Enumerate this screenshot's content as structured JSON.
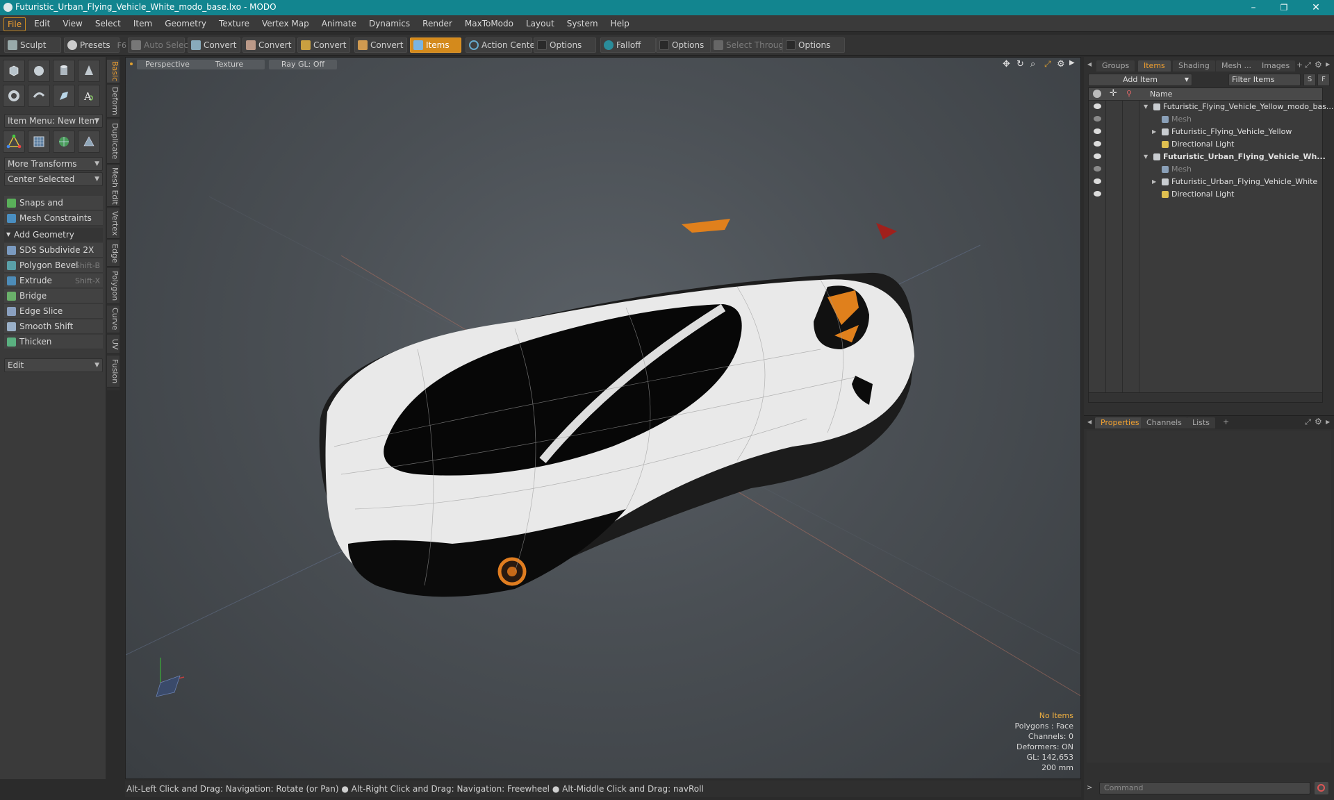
{
  "window": {
    "title": "Futuristic_Urban_Flying_Vehicle_White_modo_base.lxo - MODO",
    "controls": [
      "–",
      "❐",
      "✕"
    ]
  },
  "menu": [
    "File",
    "Edit",
    "View",
    "Select",
    "Item",
    "Geometry",
    "Texture",
    "Vertex Map",
    "Animate",
    "Dynamics",
    "Render",
    "MaxToModo",
    "Layout",
    "System",
    "Help"
  ],
  "toolbar": {
    "sculpt": "Sculpt",
    "presets": "Presets",
    "presets_key": "F6",
    "auto_select": "Auto Select",
    "convert1": "Convert",
    "convert2": "Convert",
    "convert3": "Convert",
    "convert4": "Convert",
    "items": "Items",
    "action_center": "Action Center",
    "options1": "Options",
    "falloff": "Falloff",
    "options2": "Options",
    "select_through": "Select Through",
    "options3": "Options"
  },
  "left": {
    "item_menu": "Item Menu: New Item",
    "more_transforms": "More Transforms",
    "center_selected": "Center Selected",
    "snaps": "Snaps and Precision",
    "mesh_constraints": "Mesh Constraints",
    "add_geometry": "Add Geometry",
    "tools": [
      {
        "label": "SDS Subdivide 2X",
        "key": ""
      },
      {
        "label": "Polygon Bevel",
        "key": "Shift-B"
      },
      {
        "label": "Extrude",
        "key": "Shift-X"
      },
      {
        "label": "Bridge",
        "key": ""
      },
      {
        "label": "Edge Slice",
        "key": ""
      },
      {
        "label": "Smooth Shift",
        "key": ""
      },
      {
        "label": "Thicken",
        "key": ""
      }
    ],
    "edit": "Edit"
  },
  "vtabs": [
    "Basic",
    "Deform",
    "Duplicate",
    "Mesh Edit",
    "Vertex",
    "Edge",
    "Polygon",
    "Curve",
    "UV",
    "Fusion"
  ],
  "viewport": {
    "perspective": "Perspective",
    "texture": "Texture",
    "raygl": "Ray GL: Off",
    "info": {
      "items": "No Items",
      "polygons": "Polygons : Face",
      "channels": "Channels: 0",
      "deformers": "Deformers: ON",
      "gl": "GL: 142,653",
      "scale": "200 mm"
    }
  },
  "status": "Alt-Left Click and Drag: Navigation: Rotate (or Pan) ● Alt-Right Click and Drag: Navigation: Freewheel ● Alt-Middle Click and Drag: navRoll",
  "right": {
    "tabs": [
      "Groups",
      "Items",
      "Shading",
      "Mesh ...",
      "Images"
    ],
    "add_item": "Add Item",
    "filter_items": "Filter Items",
    "s_btn": "S",
    "f_btn": "F",
    "name_col": "Name",
    "tree": [
      {
        "label": "Futuristic_Flying_Vehicle_Yellow_modo_bas...",
        "indent": 0,
        "bold": false,
        "dim": false
      },
      {
        "label": "Mesh",
        "indent": 1,
        "bold": false,
        "dim": true
      },
      {
        "label": "Futuristic_Flying_Vehicle_Yellow",
        "indent": 1,
        "bold": false,
        "dim": false
      },
      {
        "label": "Directional Light",
        "indent": 1,
        "bold": false,
        "dim": false
      },
      {
        "label": "Futuristic_Urban_Flying_Vehicle_Wh...",
        "indent": 0,
        "bold": true,
        "dim": false
      },
      {
        "label": "Mesh",
        "indent": 1,
        "bold": false,
        "dim": true
      },
      {
        "label": "Futuristic_Urban_Flying_Vehicle_White",
        "indent": 1,
        "bold": false,
        "dim": false
      },
      {
        "label": "Directional Light",
        "indent": 1,
        "bold": false,
        "dim": false
      }
    ],
    "bottom_tabs": [
      "Properties",
      "Channels",
      "Lists"
    ],
    "command_placeholder": "Command"
  }
}
